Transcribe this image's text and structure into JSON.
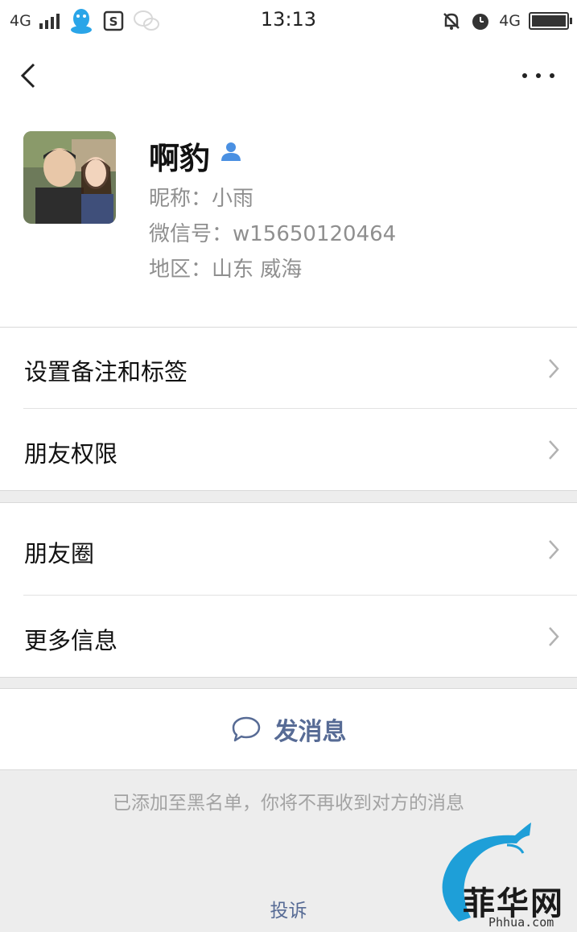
{
  "status_bar": {
    "network_left": "4G",
    "time": "13:13",
    "network_right": "4G"
  },
  "nav": {
    "back_icon": "chevron-left-icon",
    "more_icon": "more-horizontal-icon"
  },
  "profile": {
    "name": "啊豹",
    "nickname": "昵称：小雨",
    "wechat_id": "微信号：w15650120464",
    "region": "地区：山东  威海",
    "badge_icon": "contact-person-icon",
    "badge_color": "#4a90e2"
  },
  "menu_group_1": [
    {
      "label": "设置备注和标签"
    },
    {
      "label": "朋友权限"
    }
  ],
  "menu_group_2": [
    {
      "label": "朋友圈"
    },
    {
      "label": "更多信息"
    }
  ],
  "send_message": {
    "label": "发消息",
    "icon": "chat-bubble-icon",
    "color": "#576b95"
  },
  "blacklist_note": "已添加至黑名单，你将不再收到对方的消息",
  "report_link": "投诉",
  "watermark": {
    "text": "菲华网",
    "url": "Phhua.com"
  }
}
